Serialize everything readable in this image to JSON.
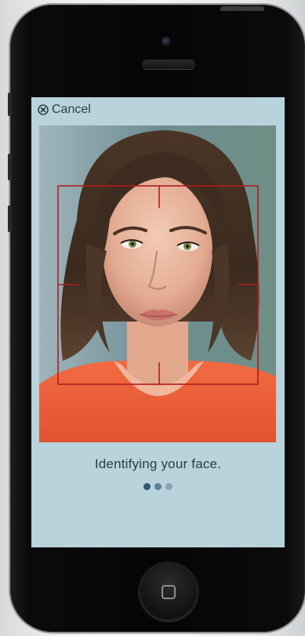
{
  "header": {
    "cancel_label": "Cancel",
    "cancel_icon": "close-circle-icon"
  },
  "status": {
    "message": "Identifying your face."
  },
  "progress": {
    "total_steps": 3,
    "current_step": 1
  },
  "colors": {
    "screen_background": "#b8d3dc",
    "frame_red": "#b01e1e",
    "dot_active": "#2f5875",
    "dot_mid": "#5d7f95",
    "dot_inactive": "#8aa2b1",
    "text": "#2b3b47"
  }
}
